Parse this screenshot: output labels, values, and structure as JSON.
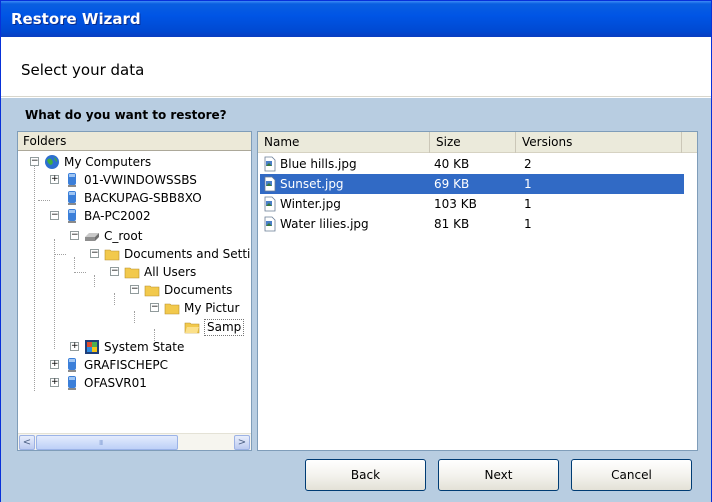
{
  "window": {
    "title": "Restore Wizard"
  },
  "header": {
    "title": "Select your data"
  },
  "question": "What do you want to restore?",
  "folders": {
    "header": "Folders",
    "tree": [
      {
        "label": "My Computers",
        "icon": "globe-icon",
        "expander": "minus"
      },
      {
        "label": "01-VWINDOWSSBS",
        "icon": "computer-icon",
        "expander": "plus"
      },
      {
        "label": "BACKUPAG-SBB8XO",
        "icon": "computer-icon",
        "expander": "none"
      },
      {
        "label": "BA-PC2002",
        "icon": "computer-icon",
        "expander": "minus"
      },
      {
        "label": "C_root",
        "icon": "drive-icon",
        "expander": "minus"
      },
      {
        "label": "Documents and Setti",
        "icon": "folder-icon",
        "expander": "minus"
      },
      {
        "label": "All Users",
        "icon": "folder-icon",
        "expander": "minus"
      },
      {
        "label": "Documents",
        "icon": "folder-icon",
        "expander": "minus"
      },
      {
        "label": "My Pictur",
        "icon": "folder-icon",
        "expander": "minus"
      },
      {
        "label": "Samp",
        "icon": "folder-open-icon",
        "expander": "none"
      },
      {
        "label": "System State",
        "icon": "system-state-icon",
        "expander": "plus"
      },
      {
        "label": "GRAFISCHEPC",
        "icon": "computer-icon",
        "expander": "plus"
      },
      {
        "label": "OFASVR01",
        "icon": "computer-icon",
        "expander": "plus"
      }
    ],
    "scroll_left": "<",
    "scroll_right": ">",
    "thumb_grip": "III"
  },
  "files": {
    "columns": {
      "name": "Name",
      "size": "Size",
      "versions": "Versions"
    },
    "rows": [
      {
        "name": "Blue hills.jpg",
        "size": "40 KB",
        "versions": "2"
      },
      {
        "name": "Sunset.jpg",
        "size": "69 KB",
        "versions": "1",
        "selected": true
      },
      {
        "name": "Winter.jpg",
        "size": "103 KB",
        "versions": "1"
      },
      {
        "name": "Water lilies.jpg",
        "size": "81 KB",
        "versions": "1"
      }
    ]
  },
  "buttons": {
    "back": "Back",
    "next": "Next",
    "cancel": "Cancel"
  },
  "colors": {
    "titlebar": "#0055e5",
    "body_bg": "#b8cde1",
    "selection": "#316ac5"
  }
}
